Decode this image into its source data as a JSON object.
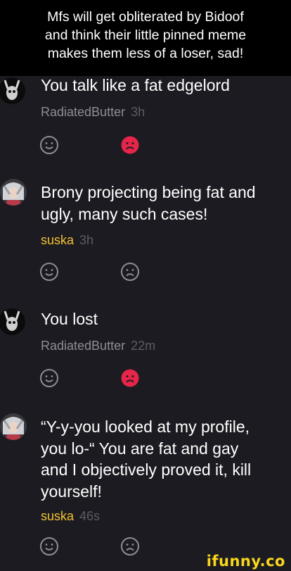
{
  "caption": {
    "lines": [
      "Mfs will get obliterated by Bidoof",
      "and think their little pinned meme",
      "makes them less of a loser, sad!"
    ]
  },
  "comments": [
    {
      "text_lines": [
        "You talk like a fat edgelord"
      ],
      "author": "RadiatedButter",
      "time": "3h",
      "author_color": "#8e8d93",
      "dislike_active": true
    },
    {
      "text_lines": [
        "Brony projecting being fat and",
        "ugly, many such cases!"
      ],
      "author": "suska",
      "time": "3h",
      "author_color": "#f2c230",
      "dislike_active": false
    },
    {
      "text_lines": [
        "You lost"
      ],
      "author": "RadiatedButter",
      "time": "22m",
      "author_color": "#8e8d93",
      "dislike_active": true
    },
    {
      "text_lines": [
        "“Y-y-you looked at my profile,",
        "you lo-“ You are fat and gay",
        "and I objectively proved it, kill",
        "yourself!"
      ],
      "author": "suska",
      "time": "46s",
      "author_color": "#f2c230",
      "dislike_active": false
    }
  ],
  "icons": {
    "smile": "smile-icon",
    "frown": "frown-icon",
    "active_color": "#e5254a",
    "inactive_color": "#8e8d93"
  },
  "watermark": "ifunny.co"
}
